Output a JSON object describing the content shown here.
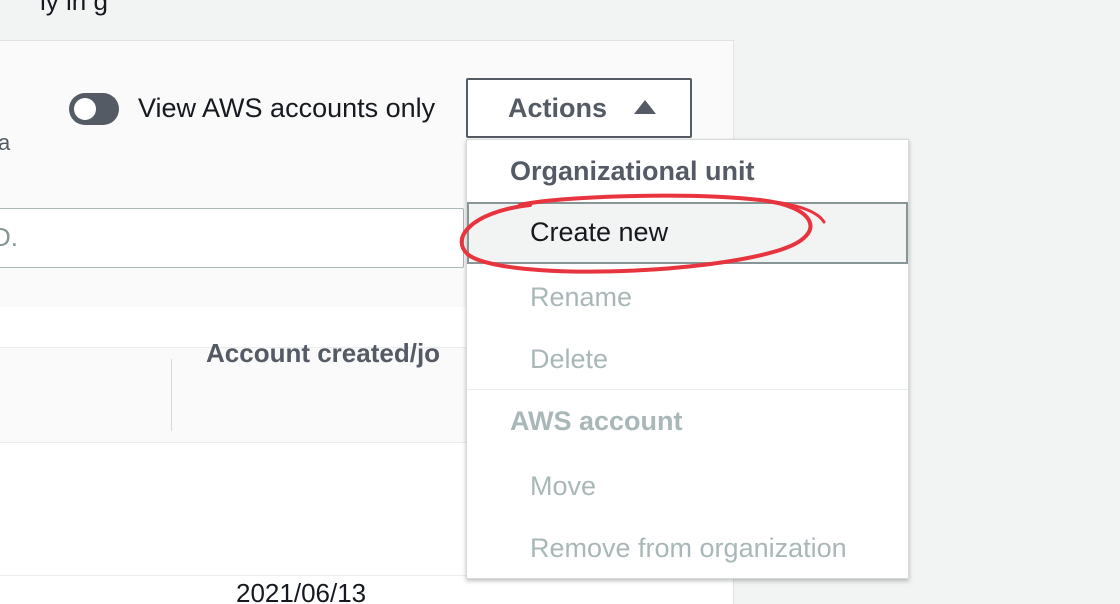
{
  "top_text_cut": "ly in g",
  "panel": {
    "toggle_label": "View AWS accounts only",
    "toggle_state": "off",
    "description_cut": "a",
    "search_placeholder_cut": "D.",
    "column_header": "Account created/jo",
    "row_date": "2021/06/13"
  },
  "actions": {
    "label": "Actions",
    "icon": "caret-up-icon"
  },
  "menu": {
    "group_ou": "Organizational unit",
    "ou_items": [
      {
        "label": "Create new",
        "enabled": true,
        "highlighted": true
      },
      {
        "label": "Rename",
        "enabled": false
      },
      {
        "label": "Delete",
        "enabled": false
      }
    ],
    "group_account": "AWS account",
    "account_items": [
      {
        "label": "Move",
        "enabled": false
      },
      {
        "label": "Remove from organization",
        "enabled": false
      }
    ]
  },
  "colors": {
    "text_primary": "#16191f",
    "text_secondary": "#545b64",
    "text_disabled": "#aab7b8",
    "annotation": "#e8343e"
  }
}
